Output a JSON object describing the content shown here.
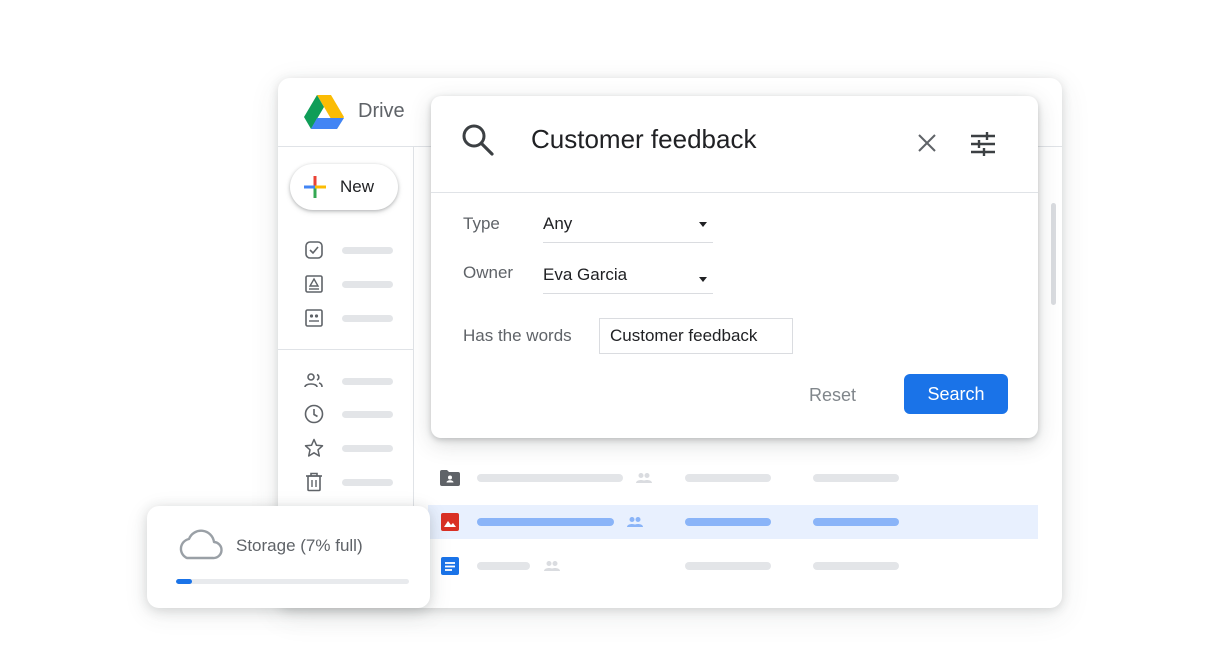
{
  "app": {
    "title": "Drive",
    "new_label": "New"
  },
  "sidebar": {
    "items": [
      {
        "icon": "priority-check-icon"
      },
      {
        "icon": "my-drive-icon"
      },
      {
        "icon": "computers-icon"
      },
      {
        "icon": "shared-with-me-icon"
      },
      {
        "icon": "recent-clock-icon"
      },
      {
        "icon": "starred-icon"
      },
      {
        "icon": "trash-icon"
      }
    ]
  },
  "search": {
    "query": "Customer feedback",
    "type_label": "Type",
    "type_value": "Any",
    "owner_label": "Owner",
    "owner_value": "Eva Garcia",
    "words_label": "Has the words",
    "words_value": "Customer feedback",
    "reset_label": "Reset",
    "search_label": "Search"
  },
  "files": [
    {
      "icon": "shared-folder-icon",
      "shared": true,
      "selected": false
    },
    {
      "icon": "image-file-icon",
      "shared": true,
      "selected": true
    },
    {
      "icon": "docs-file-icon",
      "shared": true,
      "selected": false
    }
  ],
  "storage": {
    "label": "Storage (7% full)",
    "percent": 7
  },
  "colors": {
    "accent": "#1a73e8",
    "selected_row": "#e8f0fe"
  }
}
